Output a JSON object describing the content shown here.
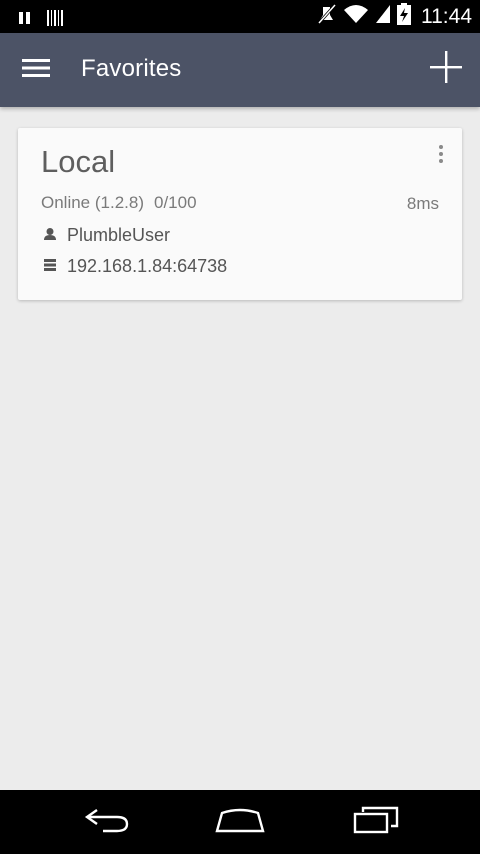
{
  "status_bar": {
    "time": "11:44",
    "left_icons": [
      "pause-icon",
      "barcode-icon"
    ],
    "right_icons": [
      "mute-icon",
      "wifi-icon",
      "signal-icon",
      "battery-charging-icon"
    ]
  },
  "app_bar": {
    "title": "Favorites",
    "menu_icon": "hamburger-menu-icon",
    "add_icon": "plus-icon",
    "background": "#4c5366"
  },
  "server_card": {
    "name": "Local",
    "status": "Online (1.2.8)",
    "users": "0/100",
    "latency": "8ms",
    "username": "PlumbleUser",
    "address": "192.168.1.84:64738",
    "menu_icon": "overflow-menu-icon"
  },
  "nav_bar": {
    "buttons": [
      "back-icon",
      "home-icon",
      "recent-apps-icon"
    ]
  }
}
